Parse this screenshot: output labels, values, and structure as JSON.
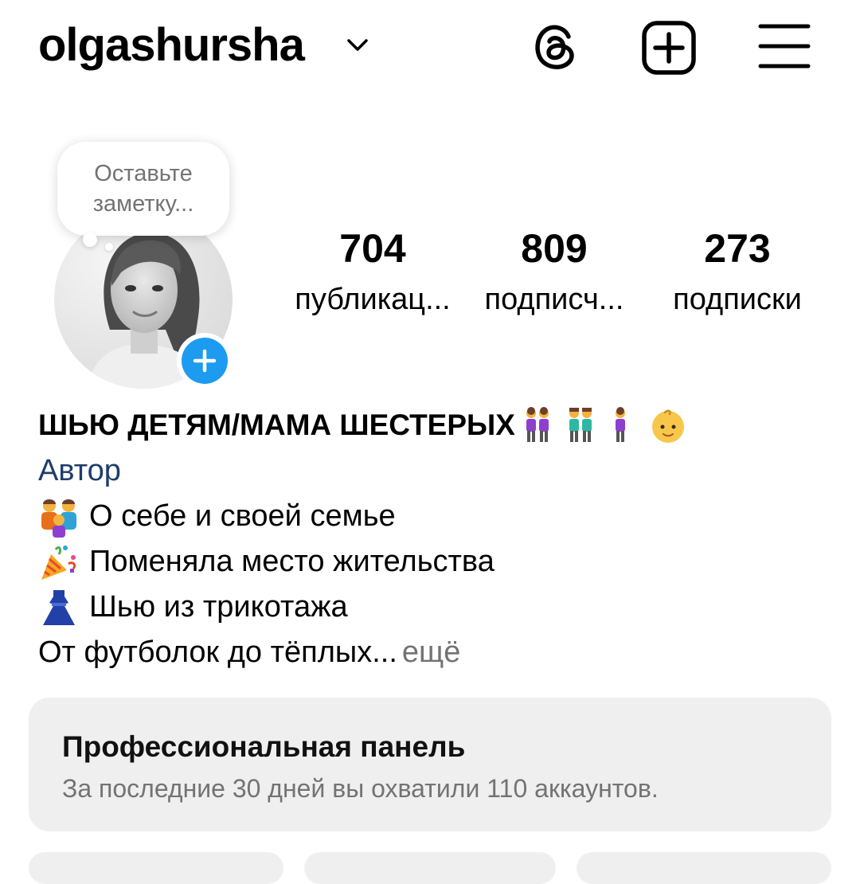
{
  "header": {
    "username": "olgashursha",
    "icons": [
      "chevron-down-icon",
      "threads-icon",
      "create-post-icon",
      "menu-icon"
    ]
  },
  "note": {
    "placeholder": "Оставьте заметку..."
  },
  "stats": {
    "posts": {
      "value": "704",
      "label": "публикац..."
    },
    "followers": {
      "value": "809",
      "label": "подписч..."
    },
    "following": {
      "value": "273",
      "label": "подписки"
    }
  },
  "bio": {
    "name": "ШЬЮ ДЕТЯМ/МАМА ШЕСТЕРЫХ",
    "category": "Автор",
    "lines": [
      {
        "icon": "family-emoji",
        "text": "О себе  и своей семье"
      },
      {
        "icon": "party-popper-emoji",
        "text": "Поменяла место жительства"
      },
      {
        "icon": "dress-emoji",
        "text": "Шью из трикотажа"
      }
    ],
    "truncated_text": "От футболок до тёплых...",
    "more_label": "ещё"
  },
  "pro_panel": {
    "title": "Профессиональная панель",
    "subtitle": "За последние 30 дней вы охватили 110 аккаунтов."
  },
  "colors": {
    "accent_blue": "#1c9bf0",
    "category_blue": "#1f3d6b",
    "secondary_text": "#737373",
    "panel_bg": "#efefef"
  }
}
